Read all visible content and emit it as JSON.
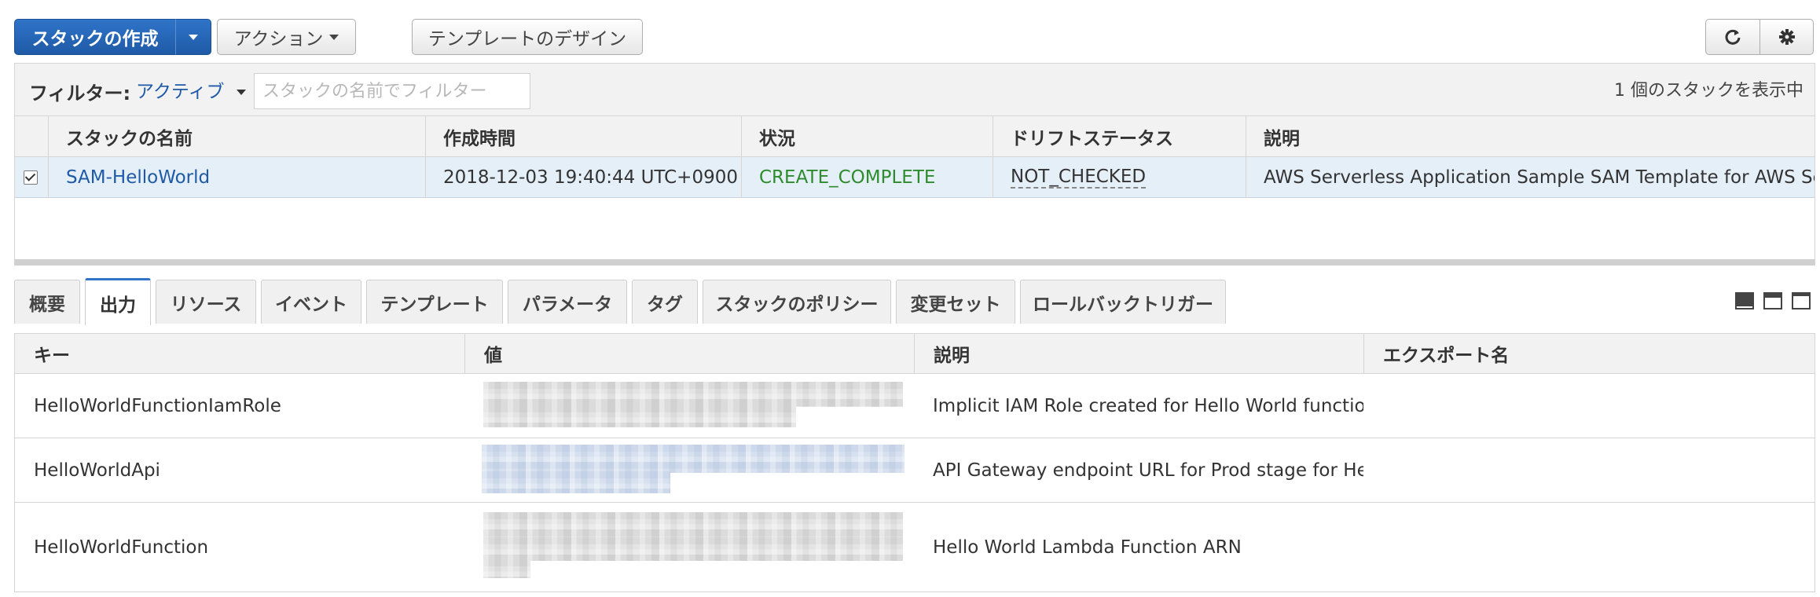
{
  "toolbar": {
    "create_stack_label": "スタックの作成",
    "actions_label": "アクション",
    "design_template_label": "テンプレートのデザイン"
  },
  "filter": {
    "label": "フィルター:",
    "value": "アクティブ",
    "placeholder": "スタックの名前でフィルター",
    "count_text": "1 個のスタックを表示中"
  },
  "stack_table": {
    "columns": [
      "スタックの名前",
      "作成時間",
      "状況",
      "ドリフトステータス",
      "説明"
    ],
    "rows": [
      {
        "name": "SAM-HelloWorld",
        "created": "2018-12-03 19:40:44 UTC+0900",
        "status": "CREATE_COMPLETE",
        "drift": "NOT_CHECKED",
        "description": "AWS Serverless Application Sample SAM Template for AWS Se…"
      }
    ]
  },
  "tabs": [
    "概要",
    "出力",
    "リソース",
    "イベント",
    "テンプレート",
    "パラメータ",
    "タグ",
    "スタックのポリシー",
    "変更セット",
    "ロールバックトリガー"
  ],
  "active_tab": "出力",
  "outputs_table": {
    "columns": [
      "キー",
      "値",
      "説明",
      "エクスポート名"
    ],
    "rows": [
      {
        "key": "HelloWorldFunctionIamRole",
        "description": "Implicit IAM Role created for Hello World function"
      },
      {
        "key": "HelloWorldApi",
        "description": "API Gateway endpoint URL for Prod stage for Hello…"
      },
      {
        "key": "HelloWorldFunction",
        "description": "Hello World Lambda Function ARN"
      }
    ]
  },
  "colors": {
    "primary": "#1f5aa6",
    "link": "#1f5aa6",
    "success": "#2e8b2e",
    "selected_row": "#e5eff8",
    "active_tab_border": "#2f74c9"
  }
}
